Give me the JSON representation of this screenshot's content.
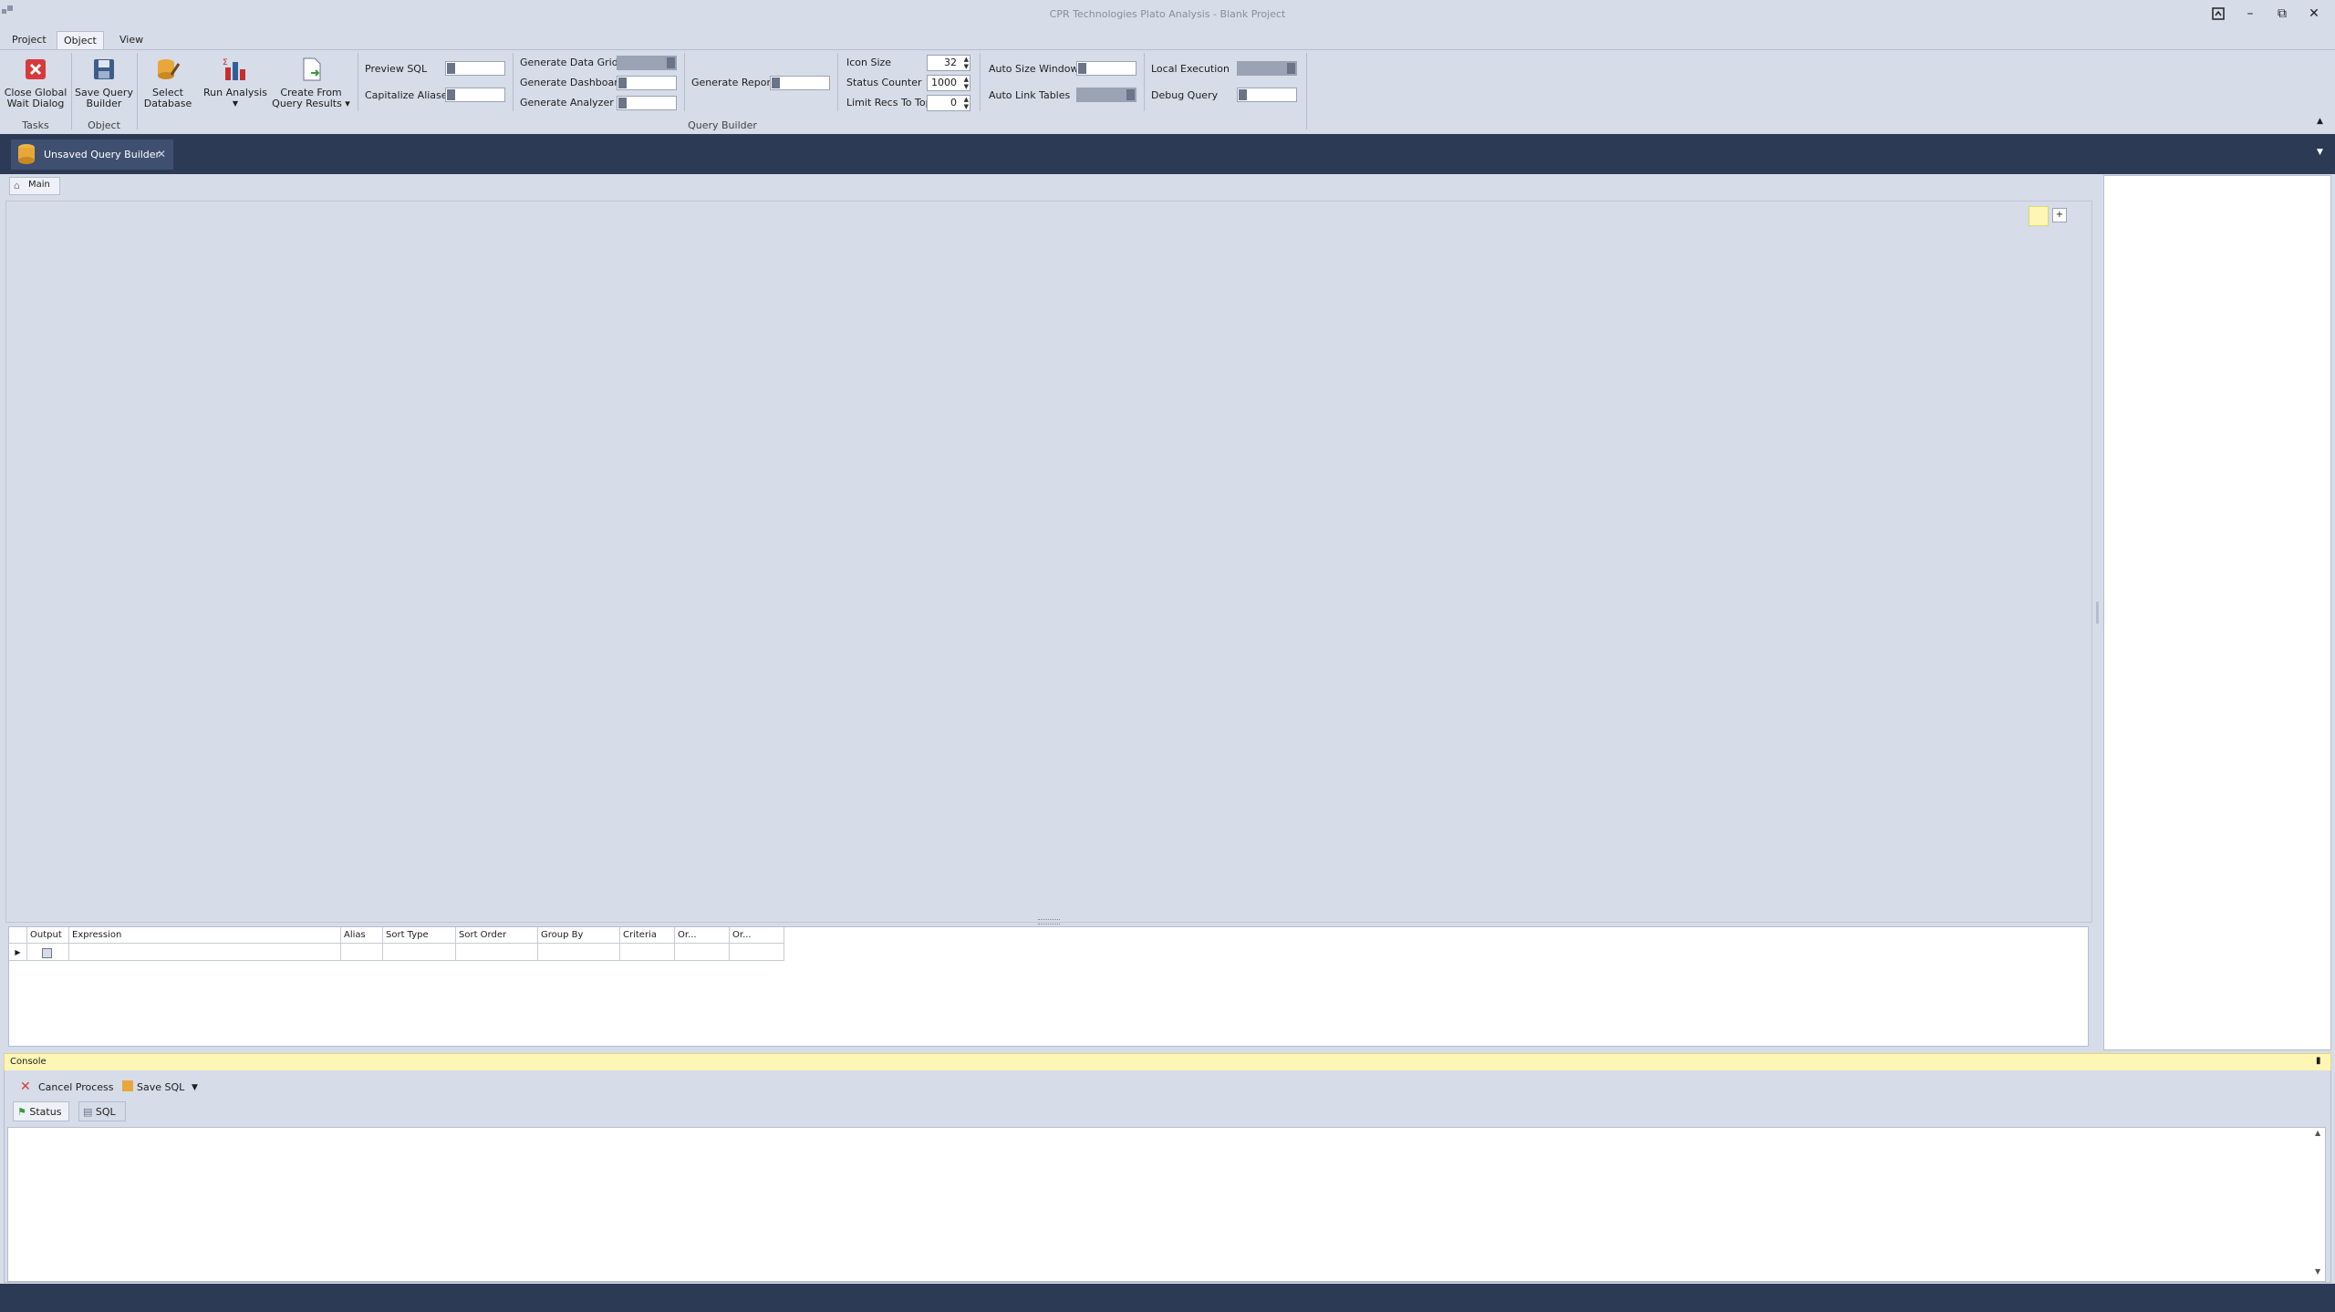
{
  "app": {
    "title": "CPR Technologies Plato Analysis - Blank Project"
  },
  "menu": {
    "tabs": [
      "Project",
      "Object",
      "View"
    ],
    "active": "Object"
  },
  "ribbon": {
    "buttons": {
      "close_global": "Close Global\nWait Dialog",
      "save_query": "Save Query\nBuilder",
      "select_db": "Select\nDatabase",
      "run_analysis": "Run Analysis",
      "create_from": "Create From\nQuery Results"
    },
    "groups": {
      "tasks": "Tasks",
      "object": "Object",
      "query_builder": "Query Builder"
    },
    "toggles": {
      "preview_sql": {
        "label": "Preview SQL",
        "on": false
      },
      "capitalize_aliases": {
        "label": "Capitalize Aliases",
        "on": false
      },
      "generate_data_grid": {
        "label": "Generate Data Grid",
        "on": true
      },
      "generate_dashboard": {
        "label": "Generate Dashboard",
        "on": false
      },
      "generate_analyzer": {
        "label": "Generate Analyzer",
        "on": false
      },
      "generate_report": {
        "label": "Generate Report",
        "on": false
      },
      "auto_size_windows": {
        "label": "Auto Size Windows",
        "on": false
      },
      "auto_link_tables": {
        "label": "Auto Link Tables",
        "on": true
      },
      "local_execution": {
        "label": "Local Execution",
        "on": true
      },
      "debug_query": {
        "label": "Debug Query",
        "on": false
      }
    },
    "spinners": {
      "icon_size": {
        "label": "Icon Size",
        "value": "32"
      },
      "status_counter": {
        "label": "Status Counter",
        "value": "1000"
      },
      "limit_recs": {
        "label": "Limit Recs To Top",
        "value": "0"
      }
    }
  },
  "document": {
    "tab_label": "Unsaved Query Builder",
    "inner_tab": "Main"
  },
  "grid": {
    "columns": [
      "Output",
      "Expression",
      "Alias",
      "Sort Type",
      "Sort Order",
      "Group By",
      "Criteria",
      "Or...",
      "Or..."
    ]
  },
  "console": {
    "title": "Console",
    "cancel_label": "Cancel Process",
    "save_sql_label": "Save SQL",
    "tabs": [
      "Status",
      "SQL"
    ]
  },
  "colors": {
    "accent_dark": "#2d3a55",
    "console_header": "#fdf6b4"
  }
}
